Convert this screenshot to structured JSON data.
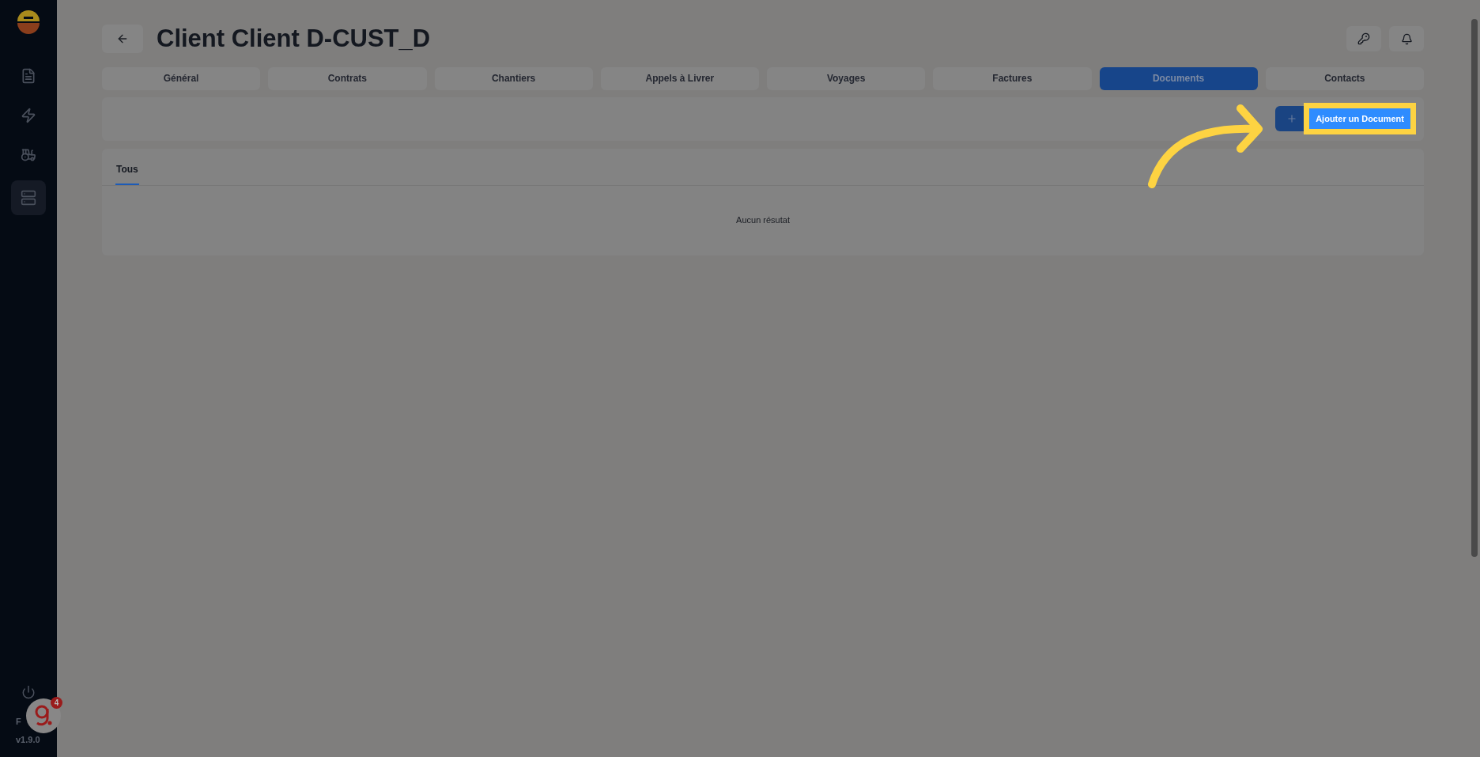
{
  "sidebar": {
    "items": [
      {
        "selected": false
      },
      {
        "selected": false
      },
      {
        "selected": false
      },
      {
        "selected": true
      }
    ],
    "language": "F",
    "version": "v1.9.0"
  },
  "help_widget": {
    "count": "4"
  },
  "header": {
    "title": "Client Client D-CUST_D"
  },
  "tabs": [
    {
      "label": "Général",
      "selected": false
    },
    {
      "label": "Contrats",
      "selected": false
    },
    {
      "label": "Chantiers",
      "selected": false
    },
    {
      "label": "Appels à Livrer",
      "selected": false
    },
    {
      "label": "Voyages",
      "selected": false
    },
    {
      "label": "Factures",
      "selected": false
    },
    {
      "label": "Documents",
      "selected": true
    },
    {
      "label": "Contacts",
      "selected": false
    }
  ],
  "toolbar": {
    "add_button": "Ajouter un Document",
    "highlighted": true
  },
  "documents": {
    "tabs": [
      {
        "label": "Tous",
        "selected": true
      }
    ],
    "empty_message": "Aucun résutat"
  }
}
